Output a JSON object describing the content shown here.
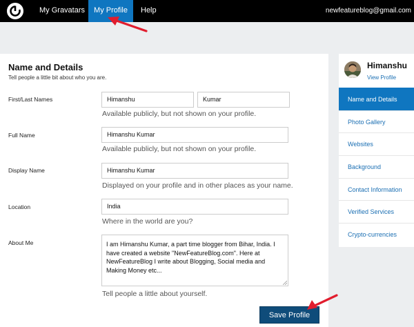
{
  "topbar": {
    "logo_icon": "gravatar-logo-icon",
    "items": [
      {
        "label": "My Gravatars"
      },
      {
        "label": "My Profile"
      },
      {
        "label": "Help"
      }
    ],
    "email": "newfeatureblog@gmail.com"
  },
  "section": {
    "title": "Name and Details",
    "subtitle": "Tell people a little bit about who you are."
  },
  "fields": {
    "names": {
      "label": "First/Last Names",
      "first": "Himanshu",
      "last": "Kumar",
      "help": "Available publicly, but not shown on your profile."
    },
    "full_name": {
      "label": "Full Name",
      "value": "Himanshu Kumar",
      "help": "Available publicly, but not shown on your profile."
    },
    "display_name": {
      "label": "Display Name",
      "value": "Himanshu Kumar",
      "help": "Displayed on your profile and in other places as your name."
    },
    "location": {
      "label": "Location",
      "value": "India",
      "help": "Where in the world are you?"
    },
    "about": {
      "label": "About Me",
      "value": "I am Himanshu Kumar, a part time blogger from Bihar, India. I have created a website \"NewFeatureBlog.com\". Here at NewFeatureBlog I write about Blogging, Social media and Making Money etc...",
      "help": "Tell people a little about yourself."
    }
  },
  "save_label": "Save Profile",
  "sidebar": {
    "name": "Himanshu",
    "view_profile": "View Profile",
    "items": [
      {
        "label": "Name and Details"
      },
      {
        "label": "Photo Gallery"
      },
      {
        "label": "Websites"
      },
      {
        "label": "Background"
      },
      {
        "label": "Contact Information"
      },
      {
        "label": "Verified Services"
      },
      {
        "label": "Crypto-currencies"
      }
    ]
  },
  "colors": {
    "accent": "#0f76c0",
    "button": "#0f4c7a",
    "annotation_arrow": "#e11d2e"
  }
}
